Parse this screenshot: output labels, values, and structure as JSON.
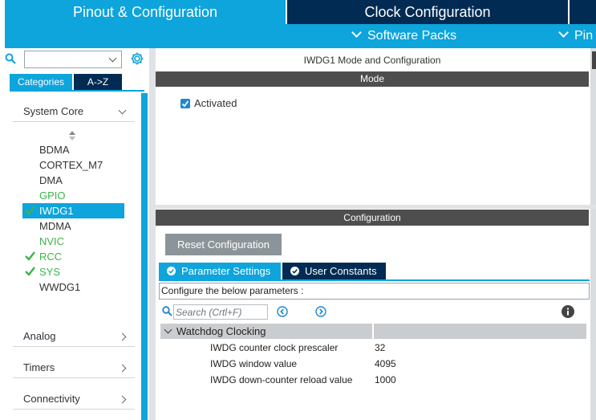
{
  "top_tabs": {
    "pinout": "Pinout & Configuration",
    "clock": "Clock Configuration"
  },
  "sub_bar": {
    "software_packs": "Software Packs",
    "pinout_short": "Pin"
  },
  "left": {
    "search_value": "",
    "tabs": {
      "categories": "Categories",
      "az": "A->Z"
    },
    "system_core": {
      "label": "System Core",
      "items": [
        {
          "label": "BDMA",
          "status": "none"
        },
        {
          "label": "CORTEX_M7",
          "status": "none"
        },
        {
          "label": "DMA",
          "status": "none"
        },
        {
          "label": "GPIO",
          "status": "configured"
        },
        {
          "label": "IWDG1",
          "status": "selected"
        },
        {
          "label": "MDMA",
          "status": "none"
        },
        {
          "label": "NVIC",
          "status": "configured"
        },
        {
          "label": "RCC",
          "status": "checked"
        },
        {
          "label": "SYS",
          "status": "checked"
        },
        {
          "label": "WWDG1",
          "status": "none"
        }
      ]
    },
    "categories": [
      "Analog",
      "Timers",
      "Connectivity"
    ]
  },
  "mode": {
    "title": "IWDG1 Mode and Configuration",
    "bar": "Mode",
    "activated_label": "Activated",
    "activated": true
  },
  "config": {
    "bar": "Configuration",
    "reset_button": "Reset Configuration",
    "tabs": {
      "params": "Parameter Settings",
      "constants": "User Constants"
    },
    "hint": "Configure the below parameters :",
    "search_placeholder": "Search (Crtl+F)",
    "group": "Watchdog Clocking",
    "params": [
      {
        "name": "IWDG counter clock prescaler",
        "value": "32"
      },
      {
        "name": "IWDG window value",
        "value": "4095"
      },
      {
        "name": "IWDG down-counter reload value",
        "value": "1000"
      }
    ]
  },
  "colors": {
    "accent": "#0ea4dc",
    "dark": "#022b53",
    "bar": "#4e4e4e",
    "green": "#3cb44a"
  }
}
